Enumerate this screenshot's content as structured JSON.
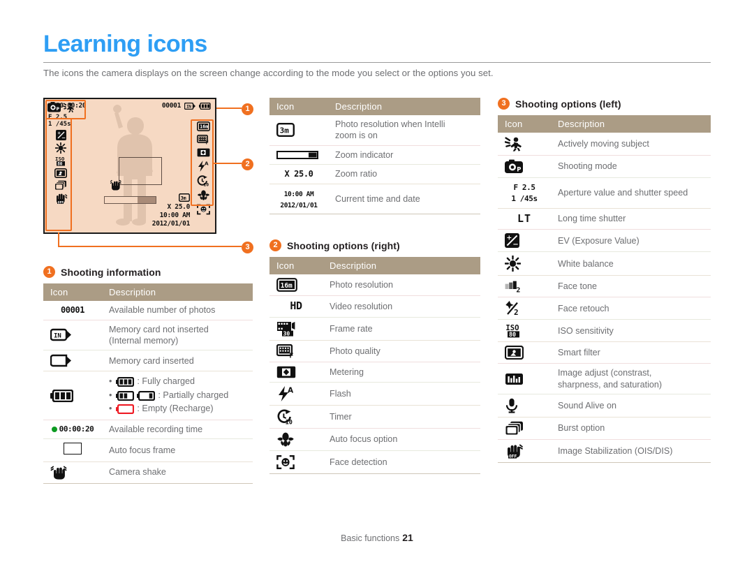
{
  "page": {
    "title": "Learning icons",
    "intro": "The icons the camera displays on the screen change according to the mode you select or the options you set.",
    "footer_label": "Basic functions",
    "footer_page": "21",
    "accent_color": "#f07020",
    "title_color": "#2e9ef4",
    "table_header_color": "#ab9c85"
  },
  "lcd": {
    "rec_time": "00:00:20",
    "shots_remaining": "00001",
    "memory_icon": "memory-card-internal-icon",
    "battery_icon": "battery-full-icon",
    "aperture": "F 2.5",
    "shutter": "1 /45s",
    "photo_resolution_intelli": "3m",
    "zoom_ratio": "X 25.0",
    "time": "10:00 AM",
    "date": "2012/01/01",
    "left_icons": [
      "shooting-mode-icon",
      "actively-moving-subject-icon",
      "ev-exposure-icon",
      "white-balance-icon",
      "iso-sensitivity-icon",
      "smart-filter-icon",
      "burst-option-icon",
      "image-stabilization-off-icon"
    ],
    "right_icons": [
      "photo-resolution-icon",
      "photo-quality-icon",
      "metering-icon",
      "flash-auto-icon",
      "timer-10s-icon",
      "auto-focus-macro-icon",
      "face-detection-icon"
    ],
    "callouts": [
      "1",
      "2",
      "3"
    ]
  },
  "sections": {
    "shooting_information": {
      "badge": "1",
      "label": "Shooting information",
      "columns": [
        "Icon",
        "Description"
      ],
      "rows": [
        {
          "icon": "available-photos-icon",
          "icon_text": "00001",
          "desc": "Available number of photos"
        },
        {
          "icon": "memory-card-not-inserted-icon",
          "icon_text": "",
          "desc": "Memory card not inserted\n(Internal memory)"
        },
        {
          "icon": "memory-card-inserted-icon",
          "icon_text": "",
          "desc": "Memory card inserted"
        },
        {
          "icon": "battery-icon",
          "icon_text": "",
          "desc_list": [
            {
              "icon": "battery-full-icon",
              "text": ": Fully charged"
            },
            {
              "icon": "battery-partial-icon",
              "text": ": Partially charged"
            },
            {
              "icon": "battery-empty-icon",
              "text": ": Empty (Recharge)"
            }
          ]
        },
        {
          "icon": "recording-time-icon",
          "icon_text": "00:00:20",
          "desc": "Available recording time"
        },
        {
          "icon": "auto-focus-frame-icon",
          "icon_text": "",
          "desc": "Auto focus frame"
        },
        {
          "icon": "camera-shake-icon",
          "icon_text": "",
          "desc": "Camera shake"
        }
      ]
    },
    "zoom_table": {
      "columns": [
        "Icon",
        "Description"
      ],
      "rows": [
        {
          "icon": "photo-resolution-intelli-icon",
          "icon_text": "3m",
          "desc": "Photo resolution when Intelli\nzoom is on"
        },
        {
          "icon": "zoom-indicator-icon",
          "icon_text": "",
          "desc": "Zoom indicator"
        },
        {
          "icon": "zoom-ratio-icon",
          "icon_text": "X 25.0",
          "desc": "Zoom ratio"
        },
        {
          "icon": "time-date-icon",
          "icon_text": "10:00 AM\n2012/01/01",
          "desc": "Current time and date"
        }
      ]
    },
    "shooting_options_right": {
      "badge": "2",
      "label": "Shooting options (right)",
      "columns": [
        "Icon",
        "Description"
      ],
      "rows": [
        {
          "icon": "photo-resolution-icon",
          "icon_text": "16m",
          "desc": "Photo resolution"
        },
        {
          "icon": "video-resolution-icon",
          "icon_text": "HD",
          "desc": "Video resolution"
        },
        {
          "icon": "frame-rate-icon",
          "icon_text": "30",
          "desc": "Frame rate"
        },
        {
          "icon": "photo-quality-icon",
          "icon_text": "",
          "desc": "Photo quality"
        },
        {
          "icon": "metering-icon",
          "icon_text": "",
          "desc": "Metering"
        },
        {
          "icon": "flash-auto-icon",
          "icon_text": "A",
          "desc": "Flash"
        },
        {
          "icon": "timer-icon",
          "icon_text": "10",
          "desc": "Timer"
        },
        {
          "icon": "auto-focus-option-icon",
          "icon_text": "",
          "desc": "Auto focus option"
        },
        {
          "icon": "face-detection-icon",
          "icon_text": "",
          "desc": "Face detection"
        }
      ]
    },
    "shooting_options_left": {
      "badge": "3",
      "label": "Shooting options (left)",
      "columns": [
        "Icon",
        "Description"
      ],
      "rows": [
        {
          "icon": "actively-moving-subject-icon",
          "icon_text": "",
          "desc": "Actively moving subject"
        },
        {
          "icon": "shooting-mode-icon",
          "icon_text": "",
          "desc": "Shooting mode"
        },
        {
          "icon": "aperture-shutter-icon",
          "icon_text": "F 2.5\n1 /45s",
          "desc": "Aperture value and shutter speed"
        },
        {
          "icon": "long-time-shutter-icon",
          "icon_text": "LT",
          "desc": "Long time shutter"
        },
        {
          "icon": "ev-exposure-icon",
          "icon_text": "",
          "desc": "EV (Exposure Value)"
        },
        {
          "icon": "white-balance-icon",
          "icon_text": "",
          "desc": "White balance"
        },
        {
          "icon": "face-tone-icon",
          "icon_text": "",
          "desc": "Face tone"
        },
        {
          "icon": "face-retouch-icon",
          "icon_text": "",
          "desc": "Face retouch"
        },
        {
          "icon": "iso-sensitivity-icon",
          "icon_text": "80",
          "desc": "ISO sensitivity"
        },
        {
          "icon": "smart-filter-icon",
          "icon_text": "",
          "desc": "Smart filter"
        },
        {
          "icon": "image-adjust-icon",
          "icon_text": "",
          "desc": "Image adjust (constrast,\nsharpness, and saturation)"
        },
        {
          "icon": "sound-alive-icon",
          "icon_text": "",
          "desc": "Sound Alive on"
        },
        {
          "icon": "burst-option-icon",
          "icon_text": "",
          "desc": "Burst option"
        },
        {
          "icon": "image-stabilization-icon",
          "icon_text": "",
          "desc": "Image Stabilization (OIS/DIS)"
        }
      ]
    }
  }
}
